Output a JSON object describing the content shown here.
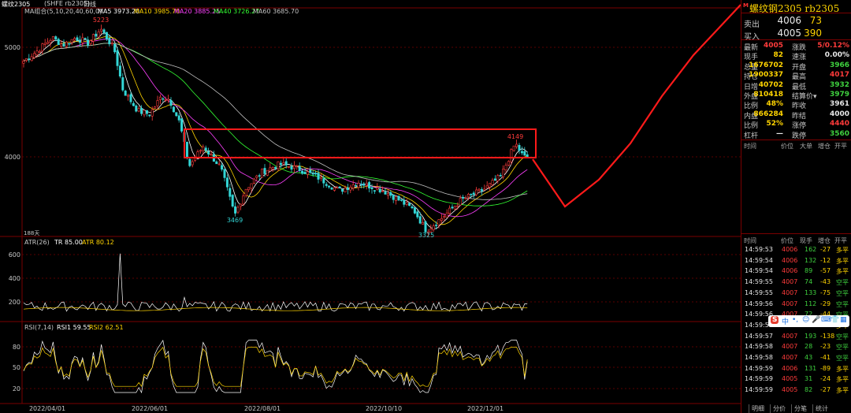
{
  "top": {
    "symbol": "螺纹2305",
    "exchange": "(SHFE rb2305)",
    "period": "日线"
  },
  "legend": {
    "ma_name": "MA组合(5,10,20,40,60,0)",
    "ma5": "MA5 3973.20",
    "ma10": "MA10 3985.70",
    "ma20": "MA20 3885.25",
    "ma40": "MA40 3726.27",
    "ma60": "MA60 3685.70",
    "atr": "ATR(26)",
    "tr": "TR 85.00",
    "atr_val": "ATR 80.12",
    "rsi": "RSI(7,14)",
    "rsi1": "RSI1 59.55",
    "rsi2": "RSI2 62.51"
  },
  "annotations": {
    "high1": "5223",
    "low1": "3469",
    "low2": "3325",
    "high2": "4149",
    "bar_count": "188天"
  },
  "colors": {
    "up": "#ff3b3b",
    "down": "#33d6d6",
    "ma5": "#ffffff",
    "ma10": "#ffd400",
    "ma20": "#ff40ff",
    "ma40": "#33ff33",
    "ma60": "#c0c0c0",
    "grid": "#5a0000",
    "drawing": "#ff1a1a"
  },
  "chart_data": {
    "type": "candlestick",
    "ylabels_price": [
      "5000",
      "4000"
    ],
    "ylabels_atr": [
      "600",
      "400",
      "200"
    ],
    "ylabels_rsi": [
      "80",
      "50",
      "20"
    ],
    "xlabels": [
      "2022/04/01",
      "2022/06/01",
      "2022/08/01",
      "2022/10/10",
      "2022/12/01"
    ],
    "price_ylim": [
      3270,
      5420
    ],
    "key_points": [
      {
        "label": "2022/04/01",
        "close": 4920
      },
      {
        "date_hint": "peak",
        "close": 5223
      },
      {
        "label": "2022/06/01",
        "close": 4420
      },
      {
        "date_hint": "low",
        "close": 3469
      },
      {
        "label": "2022/08/01",
        "close": 3880
      },
      {
        "label": "2022/10/10",
        "close": 3700
      },
      {
        "date_hint": "low",
        "close": 3325
      },
      {
        "label": "2022/12/01",
        "close": 3720
      },
      {
        "date_hint": "high",
        "close": 4149
      },
      {
        "date_hint": "last",
        "close": 4005
      }
    ],
    "atr_spike": 600,
    "rsi_last": [
      59.55,
      62.51
    ]
  },
  "side": {
    "title": "螺纹钢2305  rb2305",
    "m_label": "M",
    "sell_label": "卖出",
    "sell_price": "4006",
    "sell_vol": "73",
    "buy_label": "买入",
    "buy_price": "4005",
    "buy_vol": "390",
    "quote_rows": [
      {
        "k1": "最新",
        "v1": "4005",
        "c1": "red",
        "k2": "涨跌",
        "v2": "5/0.12%",
        "c2": "red"
      },
      {
        "k1": "现手",
        "v1": "82",
        "c1": "yel",
        "k2": "速涨",
        "v2": "0.00%",
        "c2": "wht"
      },
      {
        "k1": "总量",
        "v1": "1676702",
        "c1": "yel",
        "k2": "开盘",
        "v2": "3966",
        "c2": "grn"
      },
      {
        "k1": "持仓",
        "v1": "1900337",
        "c1": "yel",
        "k2": "最高",
        "v2": "4017",
        "c2": "red"
      },
      {
        "k1": "日增",
        "v1": "40702",
        "c1": "yel",
        "k2": "最低",
        "v2": "3932",
        "c2": "grn"
      },
      {
        "k1": "外盘",
        "v1": "810418",
        "c1": "yel",
        "k2": "结算价▾",
        "v2": "3979",
        "c2": "grn"
      },
      {
        "k1": "比例",
        "v1": "48%",
        "c1": "yel",
        "k2": "昨收",
        "v2": "3961",
        "c2": "wht"
      },
      {
        "k1": "内盘",
        "v1": "866284",
        "c1": "yel",
        "k2": "昨结",
        "v2": "4000",
        "c2": "wht"
      },
      {
        "k1": "比例",
        "v1": "52%",
        "c1": "yel",
        "k2": "涨停",
        "v2": "4440",
        "c2": "red"
      },
      {
        "k1": "杠杆",
        "v1": "—",
        "c1": "wht",
        "k2": "跌停",
        "v2": "3560",
        "c2": "grn"
      }
    ],
    "hdr1": [
      "时间",
      "价位",
      "大单",
      "增仓",
      "开平"
    ],
    "hdr2": [
      "时间",
      "价位",
      "现手",
      "增仓",
      "开平"
    ],
    "ticks": [
      {
        "t": "14:59:53",
        "p": "4006",
        "v": "162",
        "d": "-27",
        "o": "多平"
      },
      {
        "t": "14:59:54",
        "p": "4006",
        "v": "132",
        "d": "-12",
        "o": "多平"
      },
      {
        "t": "14:59:54",
        "p": "4006",
        "v": "89",
        "d": "-57",
        "o": "多平"
      },
      {
        "t": "14:59:55",
        "p": "4007",
        "v": "74",
        "d": "-43",
        "o": "空平"
      },
      {
        "t": "14:59:55",
        "p": "4007",
        "v": "133",
        "d": "-75",
        "o": "空平"
      },
      {
        "t": "14:59:56",
        "p": "4007",
        "v": "112",
        "d": "-29",
        "o": "空平"
      },
      {
        "t": "14:59:56",
        "p": "4007",
        "v": "72",
        "d": "-44",
        "o": "空平"
      },
      {
        "t": "14:59:57",
        "p": "",
        "v": "",
        "d": "",
        "o": "多平"
      },
      {
        "t": "14:59:57",
        "p": "4007",
        "v": "193",
        "d": "-138",
        "o": "空平"
      },
      {
        "t": "14:59:58",
        "p": "4007",
        "v": "28",
        "d": "-23",
        "o": "空平"
      },
      {
        "t": "14:59:58",
        "p": "4007",
        "v": "43",
        "d": "-41",
        "o": "空平"
      },
      {
        "t": "14:59:59",
        "p": "4006",
        "v": "131",
        "d": "-89",
        "o": "多平"
      },
      {
        "t": "14:59:59",
        "p": "4005",
        "v": "31",
        "d": "-24",
        "o": "多平"
      },
      {
        "t": "14:59:59",
        "p": "4005",
        "v": "82",
        "d": "-27",
        "o": "多平"
      }
    ],
    "tabs": [
      "明细",
      "分价",
      "分笔",
      "统计"
    ],
    "ime": [
      "S",
      "中",
      "•,",
      "☺",
      "🎤",
      "⌨",
      "👕",
      "▦"
    ]
  }
}
